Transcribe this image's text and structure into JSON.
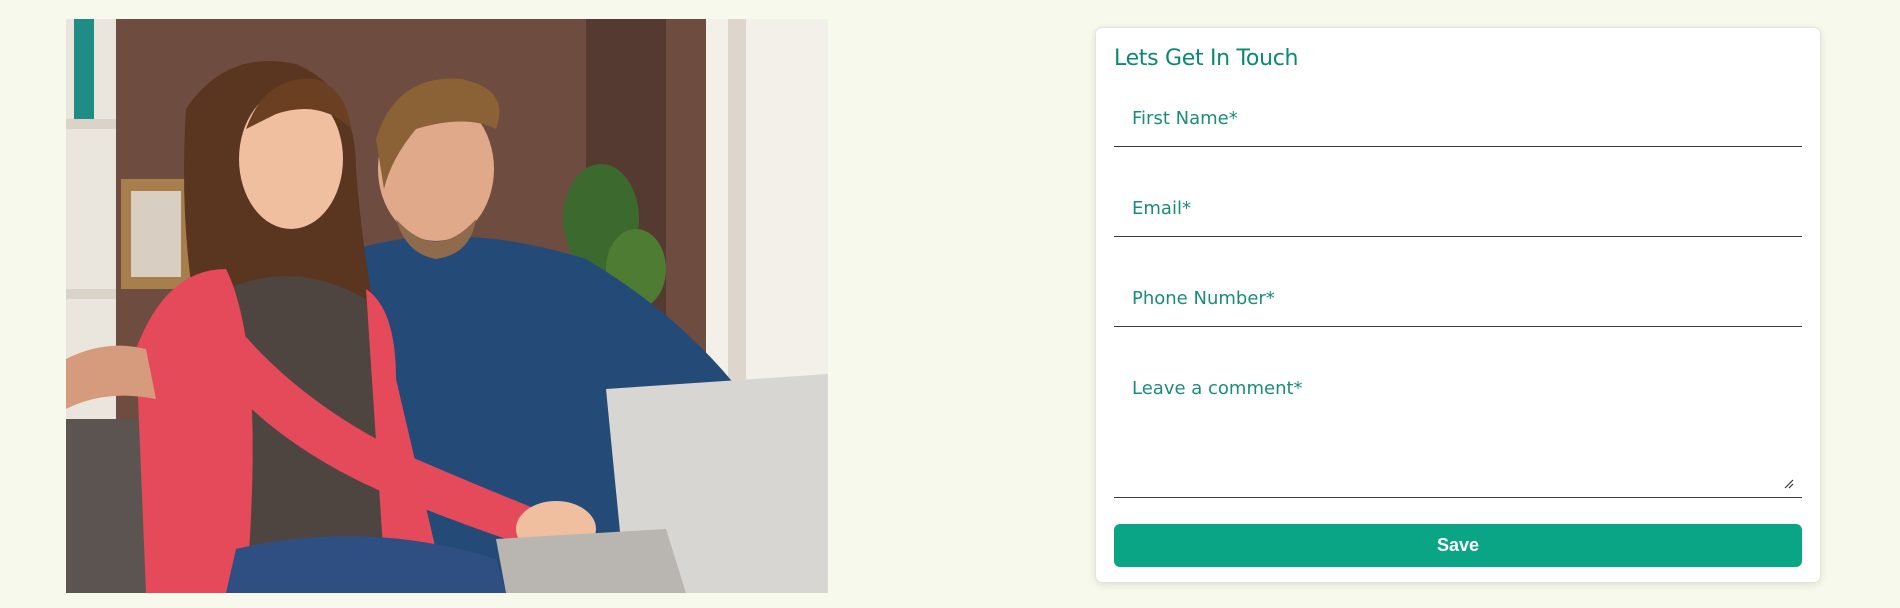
{
  "photo": {
    "subject": "couple-using-laptop"
  },
  "form": {
    "title": "Lets Get In Touch",
    "fields": {
      "first_name": {
        "placeholder": "First Name*",
        "value": ""
      },
      "email": {
        "placeholder": "Email*",
        "value": ""
      },
      "phone": {
        "placeholder": "Phone Number*",
        "value": ""
      },
      "comment": {
        "placeholder": "Leave a comment*",
        "value": ""
      }
    },
    "save_label": "Save"
  },
  "colors": {
    "page_background": "#f7f9ec",
    "accent_text": "#0a8a72",
    "button": "#0aa584"
  }
}
